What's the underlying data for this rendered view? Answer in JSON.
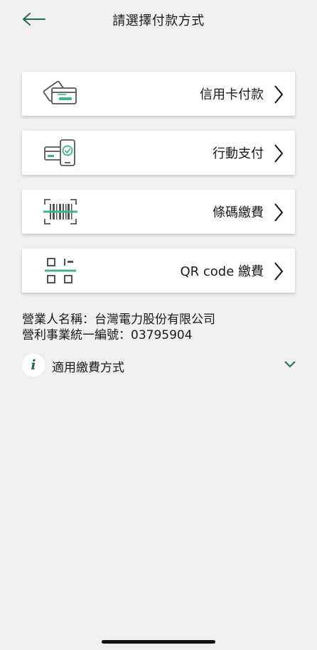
{
  "header": {
    "title": "請選擇付款方式"
  },
  "payment_options": [
    {
      "label": "信用卡付款",
      "icon": "credit-card-icon"
    },
    {
      "label": "行動支付",
      "icon": "mobile-pay-icon"
    },
    {
      "label": "條碼繳費",
      "icon": "barcode-icon"
    },
    {
      "label": "QR code 繳費",
      "icon": "qr-code-icon"
    }
  ],
  "company": {
    "name_line": "營業人名稱：台灣電力股份有限公司",
    "tax_id_line": "營利事業統一編號：03795904"
  },
  "methods": {
    "label": "適用繳費方式",
    "info_glyph": "i"
  },
  "colors": {
    "accent": "#1e6b55",
    "icon_green": "#3fb489",
    "icon_gray": "#555555",
    "background": "#f0f0f0"
  }
}
